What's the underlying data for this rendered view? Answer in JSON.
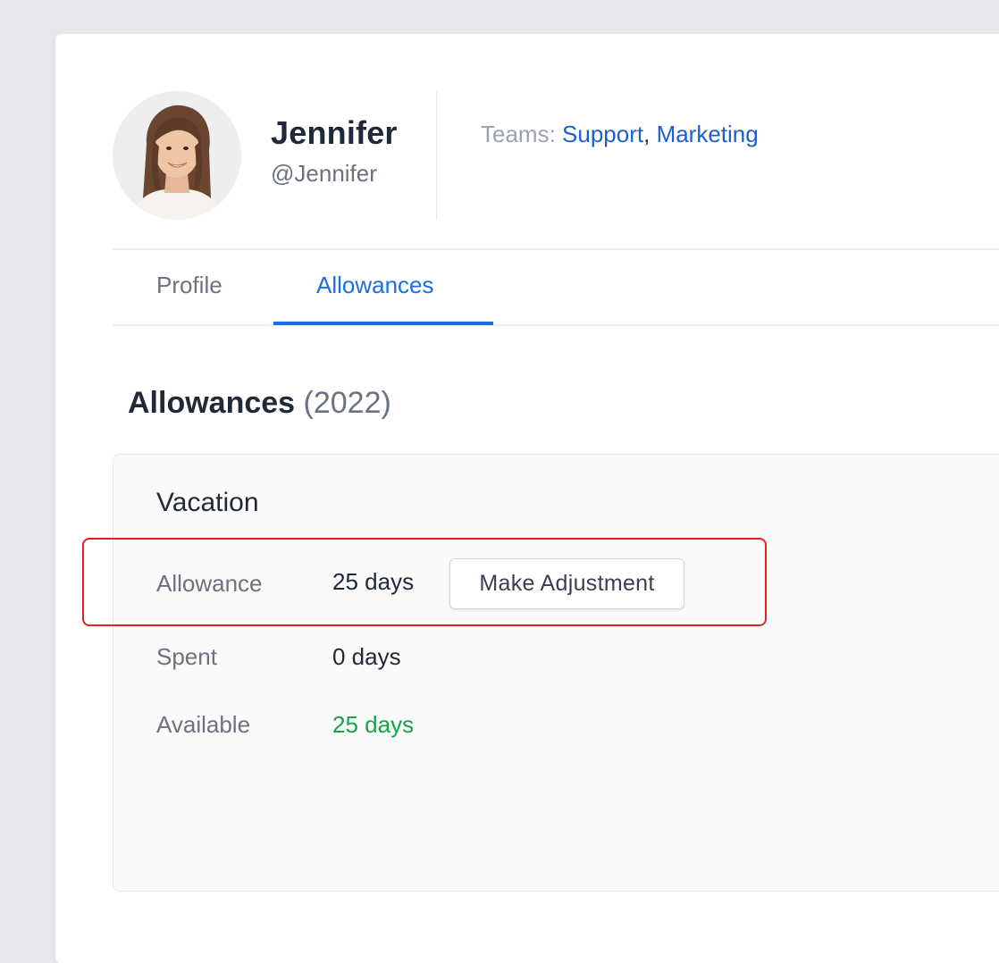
{
  "user": {
    "name": "Jennifer",
    "handle": "@Jennifer",
    "teams_label": "Teams: ",
    "teams": [
      "Support",
      "Marketing"
    ],
    "teams_separator": ", "
  },
  "tabs": [
    {
      "label": "Profile",
      "active": false
    },
    {
      "label": "Allowances",
      "active": true
    }
  ],
  "section": {
    "title": "Allowances",
    "year": "(2022)"
  },
  "vacation": {
    "title": "Vacation",
    "rows": [
      {
        "label": "Allowance",
        "value": "25 days"
      },
      {
        "label": "Spent",
        "value": "0 days"
      },
      {
        "label": "Available",
        "value": "25 days"
      }
    ],
    "adjust_button": "Make Adjustment"
  },
  "colors": {
    "accent": "#1a6fe6",
    "link": "#1d5fd1",
    "available": "#16a34a",
    "highlight": "#e02424"
  },
  "icons": {
    "avatar": "user-photo"
  }
}
